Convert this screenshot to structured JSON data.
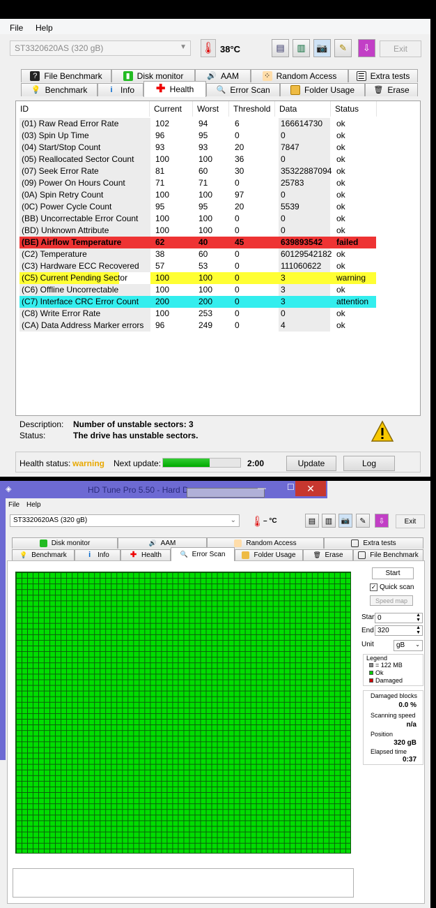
{
  "top": {
    "menu": [
      "File",
      "Help"
    ],
    "drive": "ST3320620AS (320 gB)",
    "temperature": "38°C",
    "exit_label": "Exit",
    "tabs_row1": [
      {
        "label": "File Benchmark",
        "icon": "file-benchmark-icon"
      },
      {
        "label": "Disk monitor",
        "icon": "disk-monitor-icon"
      },
      {
        "label": "AAM",
        "icon": "speaker-icon"
      },
      {
        "label": "Random Access",
        "icon": "random-access-icon"
      },
      {
        "label": "Extra tests",
        "icon": "extra-tests-icon"
      }
    ],
    "tabs_row2": [
      {
        "label": "Benchmark",
        "icon": "benchmark-icon"
      },
      {
        "label": "Info",
        "icon": "info-icon"
      },
      {
        "label": "Health",
        "icon": "health-cross-icon"
      },
      {
        "label": "Error Scan",
        "icon": "magnifier-icon"
      },
      {
        "label": "Folder Usage",
        "icon": "folder-icon"
      },
      {
        "label": "Erase",
        "icon": "trash-icon"
      }
    ],
    "columns": [
      "ID",
      "Current",
      "Worst",
      "Threshold",
      "Data",
      "Status"
    ],
    "rows": [
      [
        "(01) Raw Read Error Rate",
        "102",
        "94",
        "6",
        "166614730",
        "ok"
      ],
      [
        "(03) Spin Up Time",
        "96",
        "95",
        "0",
        "0",
        "ok"
      ],
      [
        "(04) Start/Stop Count",
        "93",
        "93",
        "20",
        "7847",
        "ok"
      ],
      [
        "(05) Reallocated Sector Count",
        "100",
        "100",
        "36",
        "0",
        "ok"
      ],
      [
        "(07) Seek Error Rate",
        "81",
        "60",
        "30",
        "35322887094",
        "ok"
      ],
      [
        "(09) Power On Hours Count",
        "71",
        "71",
        "0",
        "25783",
        "ok"
      ],
      [
        "(0A) Spin Retry Count",
        "100",
        "100",
        "97",
        "0",
        "ok"
      ],
      [
        "(0C) Power Cycle Count",
        "95",
        "95",
        "20",
        "5539",
        "ok"
      ],
      [
        "(BB) Uncorrectable Error Count",
        "100",
        "100",
        "0",
        "0",
        "ok"
      ],
      [
        "(BD) Unknown Attribute",
        "100",
        "100",
        "0",
        "0",
        "ok"
      ],
      [
        "(BE) Airflow Temperature",
        "62",
        "40",
        "45",
        "639893542",
        "failed"
      ],
      [
        "(C2) Temperature",
        "38",
        "60",
        "0",
        "60129542182",
        "ok"
      ],
      [
        "(C3) Hardware ECC Recovered",
        "57",
        "53",
        "0",
        "111060622",
        "ok"
      ],
      [
        "(C5) Current Pending Sector",
        "100",
        "100",
        "0",
        "3",
        "warning"
      ],
      [
        "(C6) Offline Uncorrectable",
        "100",
        "100",
        "0",
        "3",
        "ok"
      ],
      [
        "(C7) Interface CRC Error Count",
        "200",
        "200",
        "0",
        "3",
        "attention"
      ],
      [
        "(C8) Write Error Rate",
        "100",
        "253",
        "0",
        "0",
        "ok"
      ],
      [
        "(CA) Data Address Marker errors",
        "96",
        "249",
        "0",
        "4",
        "ok"
      ]
    ],
    "row_colors": {
      "failed": "#ee3333",
      "warning": "#ffff33",
      "attention": "#33eeee"
    },
    "description_label": "Description:",
    "description_value": "Number of unstable sectors: 3",
    "status_label": "Status:",
    "status_value": "The drive has unstable sectors.",
    "health_status_label": "Health status:",
    "health_status_value": "warning",
    "next_update_label": "Next update:",
    "next_update_progress": 0.6,
    "next_update_time": "2:00",
    "update_label": "Update",
    "log_label": "Log"
  },
  "bottom": {
    "title": "HD Tune Pro 5.50 - Hard D",
    "menu": [
      "File",
      "Help"
    ],
    "drive": "ST3320620AS (320 gB)",
    "temperature": "– °C",
    "exit_label": "Exit",
    "tabs_row1": [
      {
        "label": "Disk monitor",
        "icon": "disk-monitor-icon"
      },
      {
        "label": "AAM",
        "icon": "speaker-icon"
      },
      {
        "label": "Random Access",
        "icon": "random-access-icon"
      },
      {
        "label": "Extra tests",
        "icon": "extra-tests-icon"
      }
    ],
    "tabs_row2": [
      {
        "label": "Benchmark",
        "icon": "benchmark-icon"
      },
      {
        "label": "Info",
        "icon": "info-icon"
      },
      {
        "label": "Health",
        "icon": "health-cross-icon"
      },
      {
        "label": "Error Scan",
        "icon": "magnifier-icon"
      },
      {
        "label": "Folder Usage",
        "icon": "folder-icon"
      },
      {
        "label": "Erase",
        "icon": "trash-icon"
      },
      {
        "label": "File Benchmark",
        "icon": "file-benchmark-icon"
      }
    ],
    "start_label": "Start",
    "quick_scan_label": "Quick scan",
    "quick_scan_checked": true,
    "speed_map_label": "Speed map",
    "start_field_label": "Start",
    "start_value": "0",
    "end_field_label": "End",
    "end_value": "320",
    "unit_label": "Unit",
    "unit_value": "gB",
    "legend_title": "Legend",
    "legend_items": [
      {
        "label": "= 122 MB",
        "color": "#888888"
      },
      {
        "label": "Ok",
        "color": "#00cc00"
      },
      {
        "label": "Damaged",
        "color": "#cc0000"
      }
    ],
    "damaged_blocks_label": "Damaged blocks",
    "damaged_blocks_value": "0.0 %",
    "scanning_speed_label": "Scanning speed",
    "scanning_speed_value": "n/a",
    "position_label": "Position",
    "position_value": "320 gB",
    "elapsed_label": "Elapsed time",
    "elapsed_value": "0:37"
  }
}
